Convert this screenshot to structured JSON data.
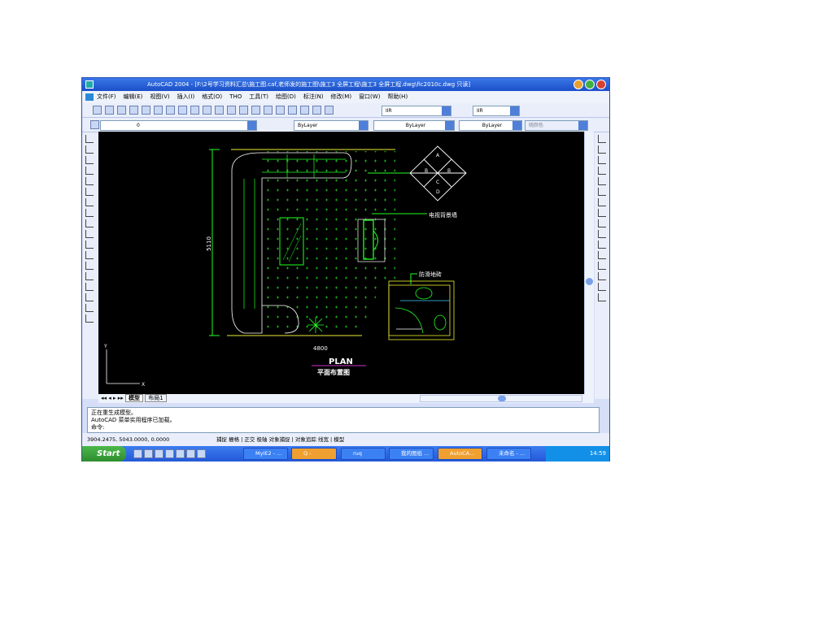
{
  "window": {
    "title": "AutoCAD 2004 - [F:\\2号学习资料汇总\\施工图.caf,老师发的施工图\\施工3 全屏工程\\施工3 全屏工程.dwg\\fic2010c.dwg 只读]"
  },
  "menu": [
    "文件(F)",
    "编辑(E)",
    "视图(V)",
    "插入(I)",
    "格式(O)",
    "THO",
    "工具(T)",
    "绘图(D)",
    "标注(N)",
    "修改(M)",
    "窗口(W)",
    "帮助(H)"
  ],
  "toolbar": {
    "text_style": "IIR",
    "dim_style": "IIR",
    "layer": "0",
    "color": "ByLayer",
    "linetype": "ByLayer",
    "lineweight": "ByLayer",
    "plot_style": "随颜色"
  },
  "drawing": {
    "dim_vertical": "5110",
    "dim_horizontal": "4800",
    "label_tv": "电视背景墙",
    "label_floor": "防滑地砖",
    "plan_title": "PLAN",
    "plan_subtitle": "平面布置图",
    "compass": [
      "A",
      "B",
      "B",
      "C",
      "D"
    ],
    "ucs_x": "X",
    "ucs_y": "Y"
  },
  "tabs": [
    "模型",
    "布局1"
  ],
  "command": {
    "lines": [
      "正在重生成模型。",
      "AutoCAD 菜单实用程序已加载。"
    ],
    "prompt": "命令:"
  },
  "status": {
    "coords": "3904.2475, 5043.0000, 0.0000",
    "buttons": [
      "捕捉",
      "栅格",
      "正交",
      "极轴",
      "对象捕捉",
      "对象追踪",
      "线宽",
      "模型"
    ]
  },
  "taskbar": {
    "start": "Start",
    "items": [
      "MyIE2 - ...",
      "Q -",
      "ruq",
      "我的图纸 ...",
      "AutoCA...",
      "未命名 - ..."
    ],
    "clock": "14:59"
  }
}
